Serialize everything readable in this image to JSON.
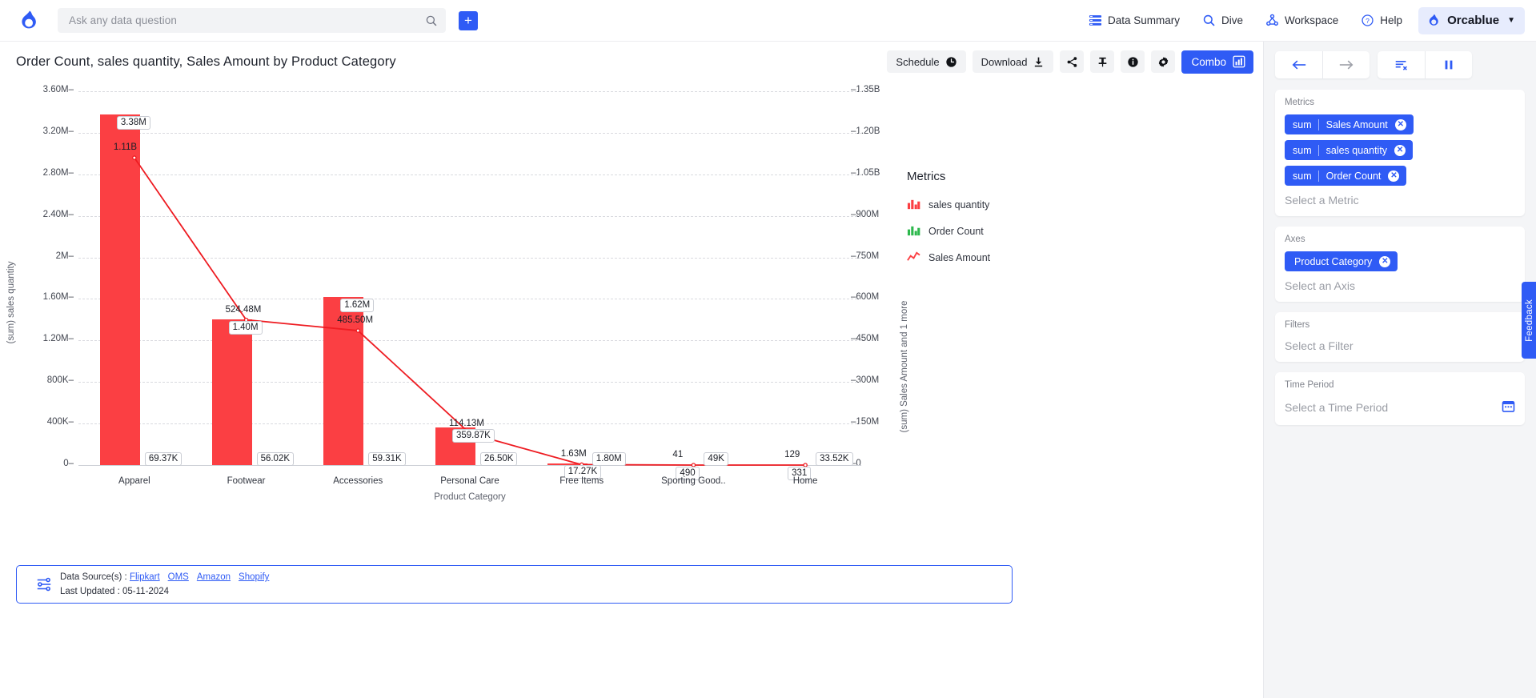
{
  "topbar": {
    "logo_icon": "orcablue-droplet-logo",
    "search": {
      "placeholder": "Ask any data question",
      "value": "",
      "icon": "search-icon"
    },
    "add_button_label": "+",
    "nav": [
      {
        "label": "Data Summary",
        "icon": "data-summary-icon"
      },
      {
        "label": "Dive",
        "icon": "search-icon"
      },
      {
        "label": "Workspace",
        "icon": "workspace-share-icon"
      },
      {
        "label": "Help",
        "icon": "help-circle-icon"
      }
    ],
    "profile": {
      "label": "Orcablue",
      "icon": "droplet-icon",
      "caret": "▼"
    }
  },
  "chart_header": {
    "title": "Order Count, sales quantity, Sales Amount by Product Category",
    "actions": [
      {
        "label": "Schedule",
        "icon": "clock-icon"
      },
      {
        "label": "Download",
        "icon": "download-icon"
      },
      {
        "label": "",
        "icon": "share-icon"
      },
      {
        "label": "",
        "icon": "pin-icon"
      },
      {
        "label": "",
        "icon": "info-icon"
      },
      {
        "label": "",
        "icon": "gear-icon"
      },
      {
        "label": "Combo",
        "icon": "combo-chart-icon"
      }
    ]
  },
  "legend": {
    "title": "Metrics",
    "items": [
      {
        "label": "sales quantity",
        "icon": "bar-chart-icon",
        "color": "#fb3f43"
      },
      {
        "label": "Order Count",
        "icon": "bar-chart-icon",
        "color": "#2db84d"
      },
      {
        "label": "Sales Amount",
        "icon": "line-chart-icon",
        "color": "#fb3f43"
      }
    ]
  },
  "chart_data": {
    "type": "bar",
    "title": "Order Count, sales quantity, Sales Amount by Product Category",
    "xlabel": "Product Category",
    "ylabel": "(sum) sales quantity",
    "ylabel_right": "(sum) Sales Amount and 1 more",
    "grid": true,
    "legend_position": "right",
    "categories": [
      "Apparel",
      "Footwear",
      "Accessories",
      "Personal Care",
      "Free Items",
      "Sporting Good..",
      "Home"
    ],
    "yticks_left": [
      "3.60M",
      "3.20M",
      "2.80M",
      "2.40M",
      "2M",
      "1.60M",
      "1.20M",
      "800K",
      "400K",
      "0"
    ],
    "ylim_left": [
      0,
      3600000
    ],
    "yticks_right": [
      "1.35B",
      "1.20B",
      "1.05B",
      "900M",
      "750M",
      "600M",
      "450M",
      "300M",
      "150M",
      "0"
    ],
    "ylim_right": [
      0,
      1350000000
    ],
    "series": [
      {
        "name": "sales quantity",
        "type": "bar",
        "axis": "left",
        "color": "#fb3f43",
        "values": [
          3380000,
          1400000,
          1620000,
          359870,
          17270,
          490,
          331
        ],
        "labels": [
          "3.38M",
          "1.40M",
          "1.62M",
          "359.87K",
          "17.27K",
          "490",
          "331"
        ]
      },
      {
        "name": "Order Count",
        "type": "bar",
        "axis": "right",
        "color": "#fb3f43",
        "values": [
          69370,
          56020,
          59310,
          26500,
          1800,
          49000,
          33520
        ],
        "labels": [
          "69.37K",
          "56.02K",
          "59.31K",
          "26.50K",
          "1.80M",
          "49K",
          "33.52K"
        ]
      },
      {
        "name": "Sales Amount",
        "type": "line",
        "axis": "right",
        "color": "#ee1c22",
        "values": [
          1110000000,
          524480000,
          485500000,
          114130000,
          1630000,
          41000,
          129
        ],
        "labels": [
          "1.11B",
          "524.48M",
          "485.50M",
          "114.13M",
          "1.63M",
          "41",
          "129"
        ]
      }
    ],
    "extra_labels": [
      "69.37K",
      "56.02K",
      "59.31K",
      "26.50K",
      "17.27K",
      "1.80M",
      "1.63M",
      "490",
      "49K",
      "41",
      "331",
      "33.52K",
      "129"
    ]
  },
  "footer": {
    "icon": "data-source-icon",
    "sources_label": "Data Source(s) :",
    "sources": [
      "Flipkart",
      "OMS",
      "Amazon",
      "Shopify"
    ],
    "last_updated_label": "Last Updated :",
    "last_updated_value": "05-11-2024"
  },
  "panel": {
    "nav": [
      {
        "icon": "arrow-left-icon",
        "state": "enabled"
      },
      {
        "icon": "arrow-right-icon",
        "state": "disabled"
      },
      {
        "icon": "clear-filters-icon",
        "state": "enabled"
      },
      {
        "icon": "pause-icon",
        "state": "enabled"
      }
    ],
    "metrics": {
      "label": "Metrics",
      "chips": [
        {
          "agg": "sum",
          "field": "Sales Amount",
          "remove": "✕"
        },
        {
          "agg": "sum",
          "field": "sales quantity",
          "remove": "✕"
        },
        {
          "agg": "sum",
          "field": "Order Count",
          "remove": "✕"
        }
      ],
      "placeholder": "Select a Metric"
    },
    "axes": {
      "label": "Axes",
      "chips": [
        {
          "field": "Product Category",
          "remove": "✕"
        }
      ],
      "placeholder": "Select an Axis"
    },
    "filters": {
      "label": "Filters",
      "placeholder": "Select a Filter"
    },
    "time_period": {
      "label": "Time Period",
      "placeholder": "Select a Time Period",
      "icon": "calendar-icon"
    },
    "feedback_label": "Feedback"
  },
  "colors": {
    "accent": "#2f5bf5",
    "bar": "#fb3f43",
    "line": "#ee1c22",
    "green": "#2db84d",
    "panel_bg": "#f4f5f7"
  }
}
